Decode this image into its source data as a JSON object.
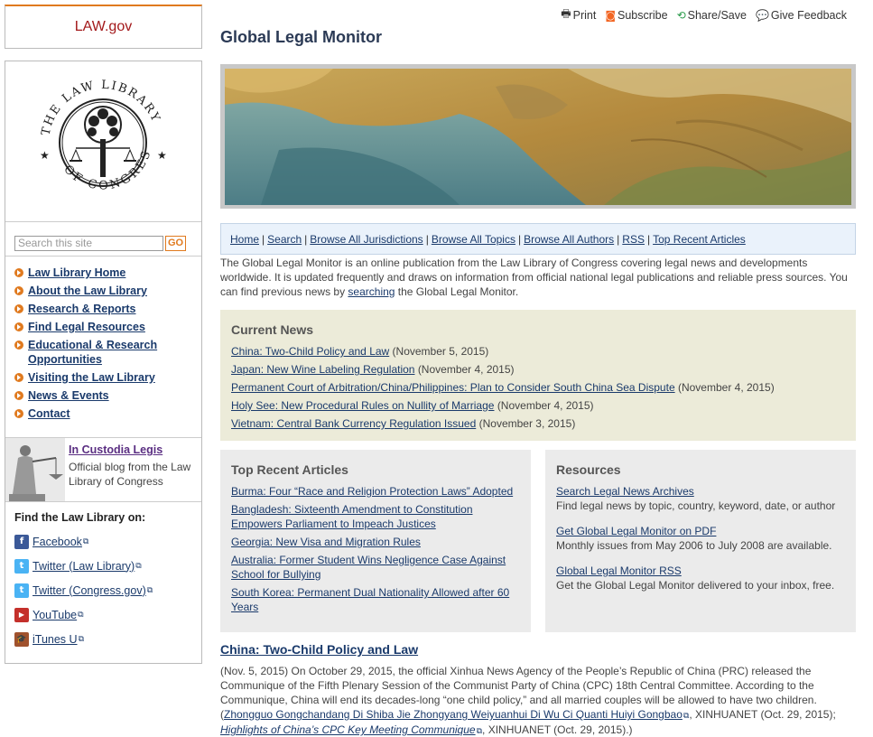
{
  "brand": {
    "lawgov": "LAW.gov"
  },
  "search": {
    "placeholder": "Search this site",
    "go_label": "GO"
  },
  "left_nav": [
    "Law Library Home",
    "About the Law Library",
    "Research & Reports",
    "Find Legal Resources",
    "Educational & Research Opportunities",
    "Visiting the Law Library",
    "News & Events",
    "Contact"
  ],
  "blog": {
    "title": "In Custodia Legis",
    "description": "Official blog from the Law Library of Congress"
  },
  "find": {
    "title": "Find the Law Library on:",
    "links": [
      {
        "label": "Facebook",
        "icon": "facebook-icon",
        "color": "#3b5998",
        "glyph": "f"
      },
      {
        "label": "Twitter (Law Library)",
        "icon": "twitter-icon",
        "color": "#4ab3f4",
        "glyph": "t"
      },
      {
        "label": "Twitter (Congress.gov)",
        "icon": "twitter-icon",
        "color": "#4ab3f4",
        "glyph": "t"
      },
      {
        "label": "YouTube",
        "icon": "youtube-icon",
        "color": "#c4302b",
        "glyph": "▶"
      },
      {
        "label": "iTunes U",
        "icon": "itunes-u-icon",
        "color": "#a0522d",
        "glyph": "🎓"
      }
    ]
  },
  "tools": [
    {
      "label": "Print",
      "icon": "print-icon",
      "glyph": "🖶"
    },
    {
      "label": "Subscribe",
      "icon": "rss-icon",
      "glyph": "◙"
    },
    {
      "label": "Share/Save",
      "icon": "share-icon",
      "glyph": "⟲"
    },
    {
      "label": "Give Feedback",
      "icon": "feedback-icon",
      "glyph": "💬"
    }
  ],
  "page_title": "Global Legal Monitor",
  "top_nav": [
    "Home",
    "Search",
    "Browse All Jurisdictions",
    "Browse All Topics",
    "Browse All Authors",
    "RSS",
    "Top Recent Articles"
  ],
  "intro": {
    "part1": "The Global Legal Monitor is an online publication from the Law Library of Congress covering legal news and developments worldwide. It is updated frequently and draws on information from official national legal publications and reliable press sources. You can find previous news by ",
    "link": "searching",
    "part2": " the Global Legal Monitor."
  },
  "current_news": {
    "heading": "Current News",
    "items": [
      {
        "title": "China: Two-Child Policy and Law",
        "date": "(November 5, 2015)"
      },
      {
        "title": "Japan: New Wine Labeling Regulation",
        "date": "(November 4, 2015)"
      },
      {
        "title": "Permanent Court of Arbitration/China/Philippines: Plan to Consider South China Sea Dispute",
        "date": "(November 4, 2015)"
      },
      {
        "title": "Holy See: New Procedural Rules on Nullity of Marriage",
        "date": "(November 4, 2015)"
      },
      {
        "title": "Vietnam: Central Bank Currency Regulation Issued",
        "date": "(November 3, 2015)"
      }
    ]
  },
  "top_recent": {
    "heading": "Top Recent Articles",
    "items": [
      "Burma: Four “Race and Religion Protection Laws” Adopted",
      "Bangladesh: Sixteenth Amendment to Constitution Empowers Parliament to Impeach Justices",
      "Georgia: New Visa and Migration Rules",
      "Australia: Former Student Wins Negligence Case Against School for Bullying",
      "South Korea: Permanent Dual Nationality Allowed after 60 Years"
    ]
  },
  "resources": {
    "heading": "Resources",
    "items": [
      {
        "title": "Search Legal News Archives",
        "desc": "Find legal news by topic, country, keyword, date, or author"
      },
      {
        "title": "Get Global Legal Monitor on PDF",
        "desc": "Monthly issues from May 2006 to July 2008 are available."
      },
      {
        "title": "Global Legal Monitor RSS",
        "desc": "Get the Global Legal Monitor delivered to your inbox, free."
      }
    ]
  },
  "article": {
    "title": "China: Two-Child Policy and Law",
    "body": "(Nov. 5, 2015) On October 29, 2015, the official Xinhua News Agency of the People’s Republic of China (PRC) released the Communique of the Fifth Plenary Session of the Communist Party of China (CPC) 18th Central Committee. According to the Communique, China will end its decades-long “one child policy,” and all married couples will be allowed to have two children. (",
    "link1": "Zhongguo Gongchandang Di Shiba Jie Zhongyang Weiyuanhui Di Wu Ci Quanti Huiyi Gongbao",
    "mid": ", XINHUANET (Oct. 29, 2015); ",
    "link2": "Highlights of China’s CPC Key Meeting Communique",
    "end": ", XINHUANET (Oct. 29, 2015).)"
  }
}
